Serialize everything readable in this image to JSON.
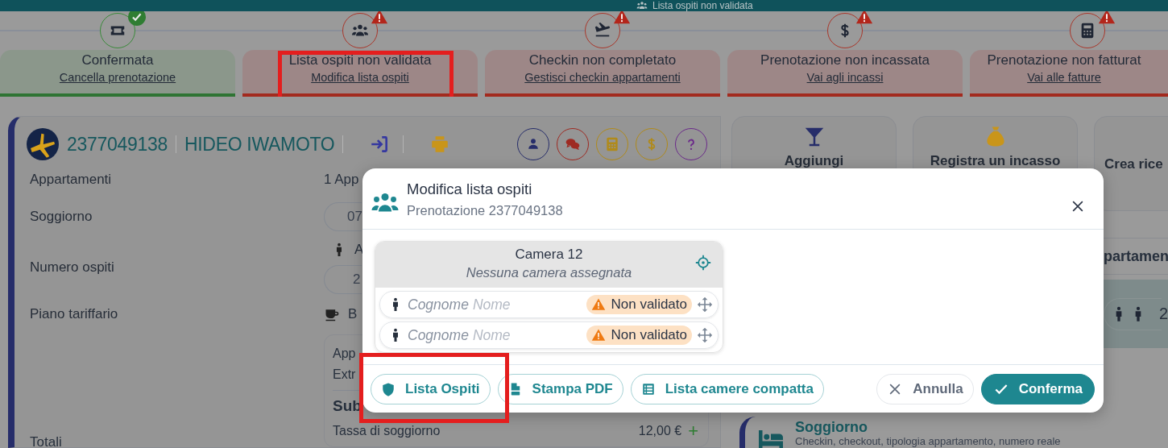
{
  "banner": {
    "text": "Lista ospiti non validata"
  },
  "steps": [
    {
      "kind": "ticket",
      "completed": true,
      "title": "Confermata",
      "link": "Cancella prenotazione",
      "highlighted": false
    },
    {
      "kind": "guests",
      "completed": false,
      "title": "Lista ospiti non validata",
      "link": "Modifica lista ospiti",
      "highlighted": true
    },
    {
      "kind": "arrival",
      "completed": false,
      "title": "Checkin non completato",
      "link": "Gestisci checkin appartamenti",
      "highlighted": false
    },
    {
      "kind": "payment",
      "completed": false,
      "title": "Prenotazione non incassata",
      "link": "Vai agli incassi",
      "highlighted": false
    },
    {
      "kind": "invoice",
      "completed": false,
      "title": "Prenotazione non fatturat",
      "link": "Vai alle fatture",
      "highlighted": false
    }
  ],
  "booking": {
    "number": "2377049138",
    "guest": "HIDEO IWAMOTO",
    "tools": [
      {
        "kind": "guest"
      },
      {
        "kind": "chat"
      },
      {
        "kind": "invoice"
      },
      {
        "kind": "payment"
      },
      {
        "kind": "help"
      }
    ],
    "fields": [
      {
        "kind": "text",
        "label": "Appartamenti",
        "value": "1 App"
      },
      {
        "kind": "pill",
        "label": "Soggiorno",
        "value": "07"
      },
      {
        "kind": "guests",
        "label": "Numero ospiti",
        "caption": "A",
        "value": "2"
      },
      {
        "kind": "rate",
        "label": "Piano tariffario",
        "value": "B"
      }
    ],
    "totals": {
      "label": "Totali",
      "lines": [
        "App",
        "Extr"
      ],
      "subtotal": "Sub",
      "tax_label": "Tassa di soggiorno",
      "tax_amount": "12,00 €",
      "add": "+"
    }
  },
  "actions": [
    {
      "kind": "extra",
      "label": "Aggiungi"
    },
    {
      "kind": "payment",
      "label": "Registra un incasso"
    },
    {
      "kind": "receipt",
      "label": "Crea rice"
    }
  ],
  "apartments": {
    "heading": "partamen",
    "count": "2"
  },
  "sections": [
    {
      "title": "Soggiorno",
      "description": "Checkin, checkout, tipologia appartamento, numero reale"
    }
  ],
  "dialog": {
    "title": "Modifica lista ospiti",
    "subtitle": "Prenotazione 2377049138",
    "rooms": [
      {
        "name": "Camera 12",
        "note": "Nessuna camera assegnata",
        "guests": [
          {
            "surname": "Cognome",
            "name": "Nome",
            "status": "Non validato",
            "validated": false
          },
          {
            "surname": "Cognome",
            "name": "Nome",
            "status": "Non validato",
            "validated": false
          }
        ]
      }
    ],
    "buttons": [
      {
        "kind": "guests",
        "label": "Lista Ospiti",
        "highlighted": true
      },
      {
        "kind": "pdf",
        "label": "Stampa PDF",
        "highlighted": false
      },
      {
        "kind": "compact",
        "label": "Lista camere compatta",
        "highlighted": false
      },
      {
        "kind": "cancel",
        "label": "Annulla",
        "highlighted": false
      },
      {
        "kind": "confirm",
        "label": "Conferma",
        "highlighted": false
      }
    ]
  }
}
